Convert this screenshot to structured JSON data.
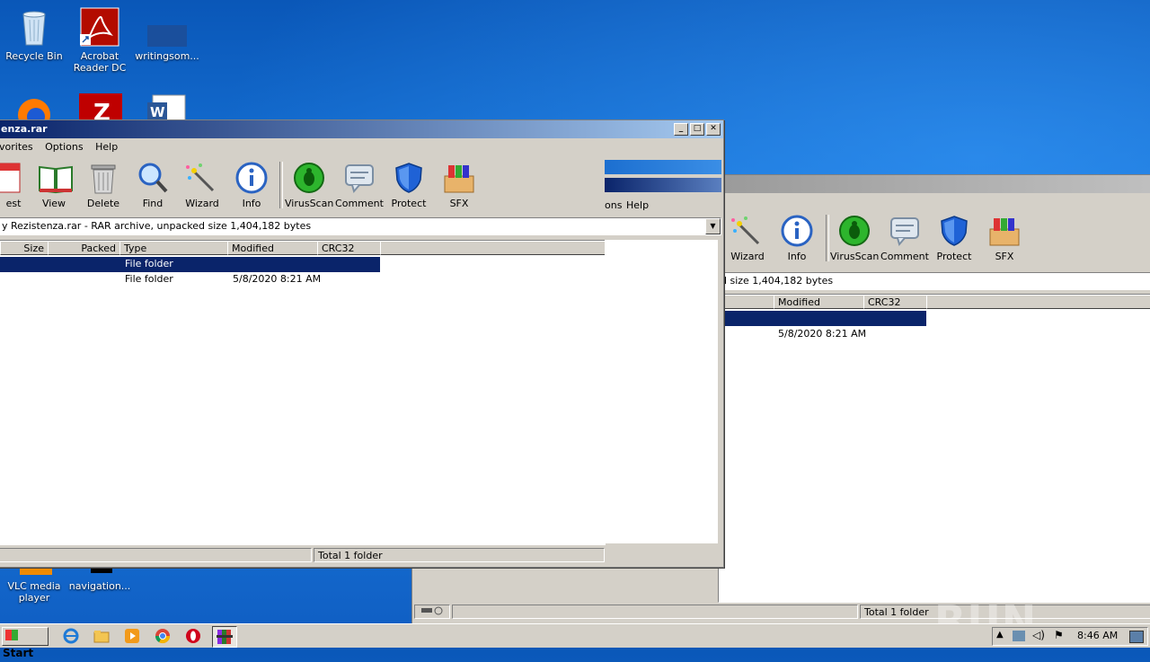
{
  "desktop": {
    "icons": [
      {
        "label": "Recycle Bin",
        "icon": "recycle-bin-icon"
      },
      {
        "label": "Acrobat Reader DC",
        "icon": "acrobat-reader-icon"
      },
      {
        "label": "writingsom...",
        "icon": "document-shortcut-icon"
      },
      {
        "label": "VLC media player",
        "icon": "vlc-icon"
      },
      {
        "label": "navigation...",
        "icon": "file-icon"
      }
    ],
    "watermark": "ANY RUN"
  },
  "front_window": {
    "title": "enza.rar",
    "menu": [
      "vorites",
      "Options",
      "Help"
    ],
    "toolbar": [
      {
        "label": "est",
        "icon": "test-icon"
      },
      {
        "label": "View",
        "icon": "book-icon"
      },
      {
        "label": "Delete",
        "icon": "trash-icon"
      },
      {
        "label": "Find",
        "icon": "magnifier-icon"
      },
      {
        "label": "Wizard",
        "icon": "magic-wand-icon"
      },
      {
        "label": "Info",
        "icon": "info-icon"
      },
      {
        "label": "VirusScan",
        "icon": "virus-scan-icon"
      },
      {
        "label": "Comment",
        "icon": "comment-icon"
      },
      {
        "label": "Protect",
        "icon": "shield-icon"
      },
      {
        "label": "SFX",
        "icon": "sfx-box-icon"
      }
    ],
    "address": "y Rezistenza.rar - RAR archive, unpacked size 1,404,182 bytes",
    "columns": [
      "Size",
      "Packed",
      "Type",
      "Modified",
      "CRC32"
    ],
    "rows": [
      {
        "type": "File folder",
        "modified": "",
        "selected": true
      },
      {
        "type": "File folder",
        "modified": "5/8/2020 8:21 AM",
        "selected": false
      }
    ],
    "status": "Total 1 folder",
    "overlap_menu": [
      "ons",
      "Help"
    ]
  },
  "back_window": {
    "toolbar": [
      {
        "label": "Wizard",
        "icon": "magic-wand-icon"
      },
      {
        "label": "Info",
        "icon": "info-icon"
      },
      {
        "label": "VirusScan",
        "icon": "virus-scan-icon"
      },
      {
        "label": "Comment",
        "icon": "comment-icon"
      },
      {
        "label": "Protect",
        "icon": "shield-icon"
      },
      {
        "label": "SFX",
        "icon": "sfx-box-icon"
      }
    ],
    "address": "d size 1,404,182 bytes",
    "columns": [
      "Modified",
      "CRC32"
    ],
    "rows": [
      {
        "modified": "",
        "selected": true
      },
      {
        "modified": "5/8/2020 8:21 AM",
        "selected": false
      }
    ],
    "status": "Total 1 folder"
  },
  "taskbar": {
    "start_label": "Start",
    "apps": [
      "ie-icon",
      "explorer-icon",
      "media-player-icon",
      "chrome-icon",
      "opera-icon",
      "winrar-icon"
    ],
    "clock": "8:46 AM"
  }
}
